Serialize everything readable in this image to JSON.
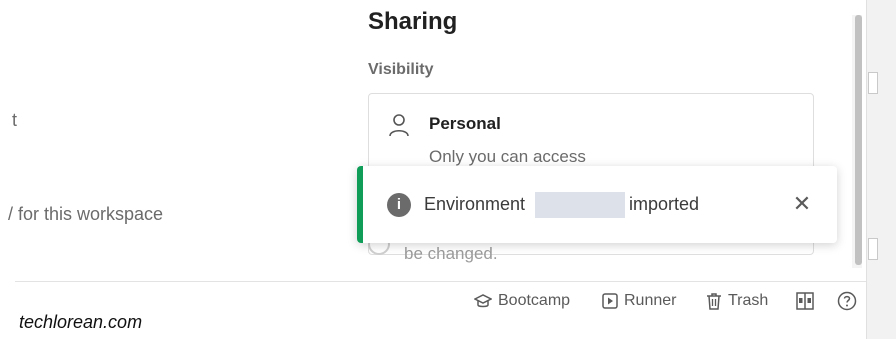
{
  "left_column": {
    "fragment_1": "t",
    "fragment_2": "/ for this workspace"
  },
  "sharing": {
    "title": "Sharing",
    "visibility_label": "Visibility",
    "option": {
      "title": "Personal",
      "description": "Only you can access"
    },
    "note_fragment": "be changed."
  },
  "toast": {
    "text_before": "Environment",
    "text_after": "imported",
    "accent_color": "#0f9d58",
    "close_glyph": "✕",
    "info_glyph": "i"
  },
  "footer": {
    "bootcamp_label": "Bootcamp",
    "runner_label": "Runner",
    "trash_label": "Trash"
  },
  "watermark": "techlorean.com"
}
